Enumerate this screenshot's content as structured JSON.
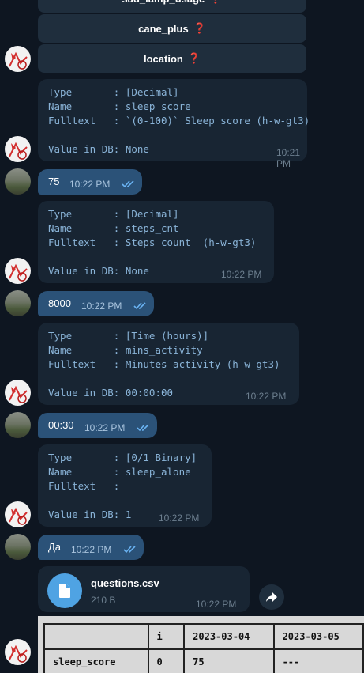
{
  "keyboard": {
    "buttons": [
      {
        "label": "sad_lamp_usage",
        "mark": "❓"
      },
      {
        "label": "cane_plus",
        "mark": "❓"
      },
      {
        "label": "location",
        "mark": "❓"
      }
    ]
  },
  "messages": {
    "m1": {
      "text": "Type       : [Decimal]\nName       : sleep_score\nFulltext   : `(0-100)` Sleep score (h-w-gt3)\n\nValue in DB: None",
      "time": "10:21 PM"
    },
    "r1": {
      "text": "75",
      "time": "10:22 PM"
    },
    "m2": {
      "text": "Type       : [Decimal]\nName       : steps_cnt\nFulltext   : Steps count  (h-w-gt3)\n\nValue in DB: None",
      "time": "10:22 PM"
    },
    "r2": {
      "text": "8000",
      "time": "10:22 PM"
    },
    "m3": {
      "text": "Type       : [Time (hours)]\nName       : mins_activity\nFulltext   : Minutes activity (h-w-gt3)\n\nValue in DB: 00:00:00",
      "time": "10:22 PM"
    },
    "r3": {
      "text": "00:30",
      "time": "10:22 PM"
    },
    "m4": {
      "text": "Type       : [0/1 Binary]\nName       : sleep_alone\nFulltext   :\n\nValue in DB: 1",
      "time": "10:22 PM"
    },
    "r4": {
      "text": "Да",
      "time": "10:22 PM"
    }
  },
  "file": {
    "name": "questions.csv",
    "size": "210 B",
    "time": "10:22 PM"
  },
  "table": {
    "headers": [
      "",
      "i",
      "2023-03-04",
      "2023-03-05"
    ],
    "rows": [
      [
        "sleep_score",
        "0",
        "75",
        "---"
      ]
    ]
  },
  "colors": {
    "background": "#0e1621",
    "incoming": "#182533",
    "outgoing": "#2b5278",
    "accent": "#4fa3e3"
  }
}
